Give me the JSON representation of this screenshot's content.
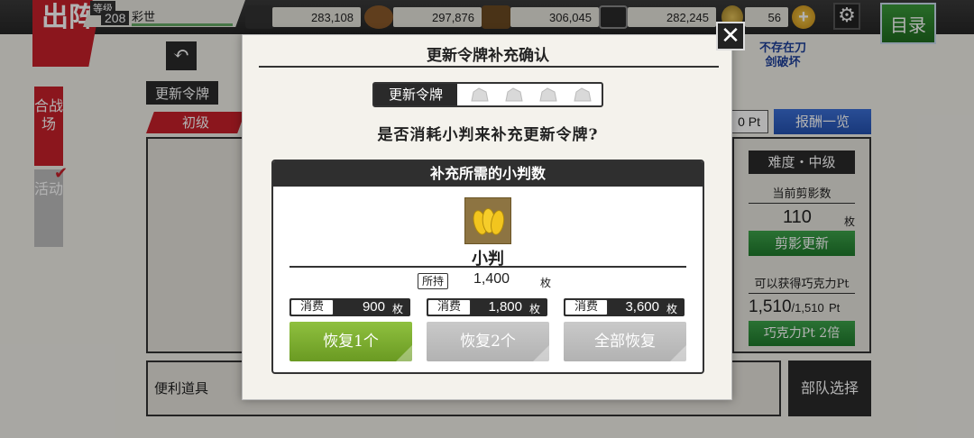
{
  "background": {
    "sortie_label": "出阵",
    "level_label": "等级",
    "level_value": "208",
    "player_name": "彩世",
    "resources": [
      {
        "icon": "charcoal-icon",
        "value": "283,108"
      },
      {
        "icon": "whetstone-icon",
        "value": "297,876"
      },
      {
        "icon": "steel-icon",
        "value": "306,045"
      },
      {
        "icon": "cooling-material-icon",
        "value": "282,245"
      },
      {
        "icon": "koban-coin-icon",
        "value": "56"
      }
    ],
    "plus_label": "+",
    "menu_label": "目录",
    "tab_war": "合战场",
    "tab_event": "活动",
    "token_label": "更新令牌",
    "difficulty_tab": "初级",
    "pt_suffix": "Pt",
    "pt_prefix": "0",
    "reward_label": "报酬一览",
    "not_exist_label": "不存在刀剑破坏",
    "difficulty_label": "难度・中级",
    "current_cut_label": "当前剪影数",
    "current_cut_value": "110",
    "current_cut_unit": "枚",
    "cut_refresh_label": "剪影更新",
    "choco_label": "可以获得巧克力Pt",
    "choco_value": "1,510",
    "choco_max": "/1,510",
    "choco_unit": "Pt",
    "choco_btn": "巧克力Pt 2倍",
    "items_label": "便利道具",
    "team_label": "部队选择"
  },
  "modal": {
    "title": "更新令牌补充确认",
    "token_label": "更新令牌",
    "token_slots_filled": 0,
    "token_slots_total": 4,
    "question": "是否消耗小判来补充更新令牌?",
    "cost_header": "补充所需的小判数",
    "item_name": "小判",
    "owned_tag": "所持",
    "owned_value": "1,400",
    "unit": "枚",
    "options": [
      {
        "tag": "消费",
        "value": "900",
        "unit": "枚",
        "button": "恢复1个",
        "enabled": true
      },
      {
        "tag": "消费",
        "value": "1,800",
        "unit": "枚",
        "button": "恢复2个",
        "enabled": false
      },
      {
        "tag": "消费",
        "value": "3,600",
        "unit": "枚",
        "button": "全部恢复",
        "enabled": false
      }
    ]
  },
  "colors": {
    "accent_red": "#c8202a",
    "enabled_green": "#7fae2f",
    "disabled_gray": "#bdbdbd",
    "reward_blue": "#2f5fc4"
  }
}
